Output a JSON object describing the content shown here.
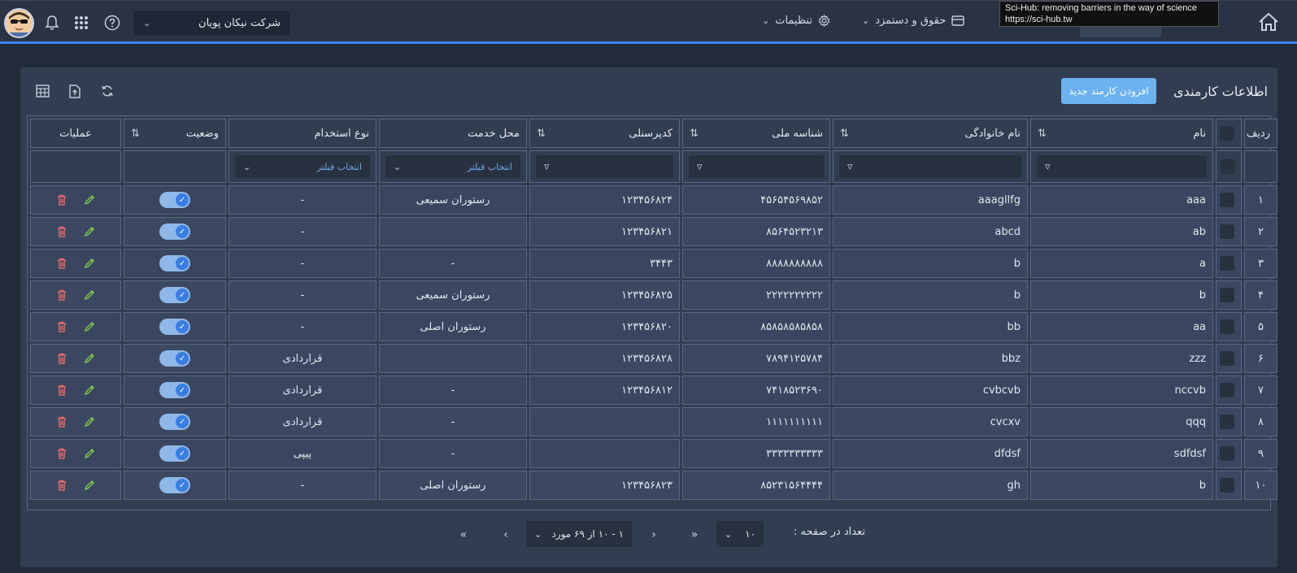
{
  "topbar": {
    "company": "شرکت نیکان پویان",
    "nav": [
      {
        "label": "تنظیمات",
        "icon": "gear-icon"
      },
      {
        "label": "حقوق و دستمزد",
        "icon": "card-icon"
      }
    ],
    "tooltip_line1": "Sci-Hub: removing barriers in the way of science",
    "tooltip_line2": "https://sci-hub.tw"
  },
  "card": {
    "title": "اطلاعات کارمندی",
    "add_button": "افزودن کارمند جدید"
  },
  "table": {
    "headers": {
      "row": "ردیف",
      "first_name": "نام",
      "last_name": "نام خانوادگی",
      "national_id": "شناسه ملی",
      "personnel_code": "کدپرسنلی",
      "service_place": "محل خدمت",
      "employment_type": "نوع استخدام",
      "status": "وضعیت",
      "operations": "عملیات"
    },
    "filter_placeholder": "انتخاب فیلتر",
    "rows": [
      {
        "row": "۱",
        "first_name": "aaa",
        "last_name": "aaagllfg",
        "national_id": "۴۵۶۵۴۵۶۹۸۵۲",
        "personnel_code": "۱۲۳۴۵۶۸۲۴",
        "service_place": "رستوران سمیعی",
        "employment_type": "-"
      },
      {
        "row": "۲",
        "first_name": "ab",
        "last_name": "abcd",
        "national_id": "۸۵۶۴۵۲۳۲۱۳",
        "personnel_code": "۱۲۳۴۵۶۸۲۱",
        "service_place": "",
        "employment_type": "-"
      },
      {
        "row": "۳",
        "first_name": "a",
        "last_name": "b",
        "national_id": "۸۸۸۸۸۸۸۸۸۸",
        "personnel_code": "۳۴۴۳",
        "service_place": "-",
        "employment_type": "-"
      },
      {
        "row": "۴",
        "first_name": "b",
        "last_name": "b",
        "national_id": "۲۲۲۲۲۲۲۲۲۲",
        "personnel_code": "۱۲۳۴۵۶۸۲۵",
        "service_place": "رستوران سمیعی",
        "employment_type": "-"
      },
      {
        "row": "۵",
        "first_name": "aa",
        "last_name": "bb",
        "national_id": "۸۵۸۵۸۵۸۵۸۵۸",
        "personnel_code": "۱۲۳۴۵۶۸۲۰",
        "service_place": "رستوران اصلی",
        "employment_type": "-"
      },
      {
        "row": "۶",
        "first_name": "zzz",
        "last_name": "bbz",
        "national_id": "۷۸۹۴۱۲۵۷۸۴",
        "personnel_code": "۱۲۳۴۵۶۸۲۸",
        "service_place": "",
        "employment_type": "قراردادی"
      },
      {
        "row": "۷",
        "first_name": "nccvb",
        "last_name": "cvbcvb",
        "national_id": "۷۴۱۸۵۲۳۶۹۰",
        "personnel_code": "۱۲۳۴۵۶۸۱۲",
        "service_place": "-",
        "employment_type": "قراردادی"
      },
      {
        "row": "۸",
        "first_name": "qqq",
        "last_name": "cvcxv",
        "national_id": "۱۱۱۱۱۱۱۱۱۱",
        "personnel_code": "",
        "service_place": "-",
        "employment_type": "قراردادی"
      },
      {
        "row": "۹",
        "first_name": "sdfdsf",
        "last_name": "dfdsf",
        "national_id": "۳۳۳۳۳۳۳۳۳۳",
        "personnel_code": "",
        "service_place": "-",
        "employment_type": "پیپی"
      },
      {
        "row": "۱۰",
        "first_name": "b",
        "last_name": "gh",
        "national_id": "۸۵۲۳۱۵۶۴۴۴۴",
        "personnel_code": "۱۲۳۴۵۶۸۲۳",
        "service_place": "رستوران اصلی",
        "employment_type": "-"
      }
    ]
  },
  "pager": {
    "per_page_label": "تعداد در صفحه :",
    "per_page_value": "۱۰",
    "range_text": "۱ - ۱۰ از ۶۹ مورد"
  },
  "colors": {
    "accent": "#3b82f6",
    "add_button": "#6cb2f0",
    "delete_icon": "#e06a6a",
    "edit_icon": "#7cc24f",
    "toggle_on": "#8fb8e8"
  }
}
